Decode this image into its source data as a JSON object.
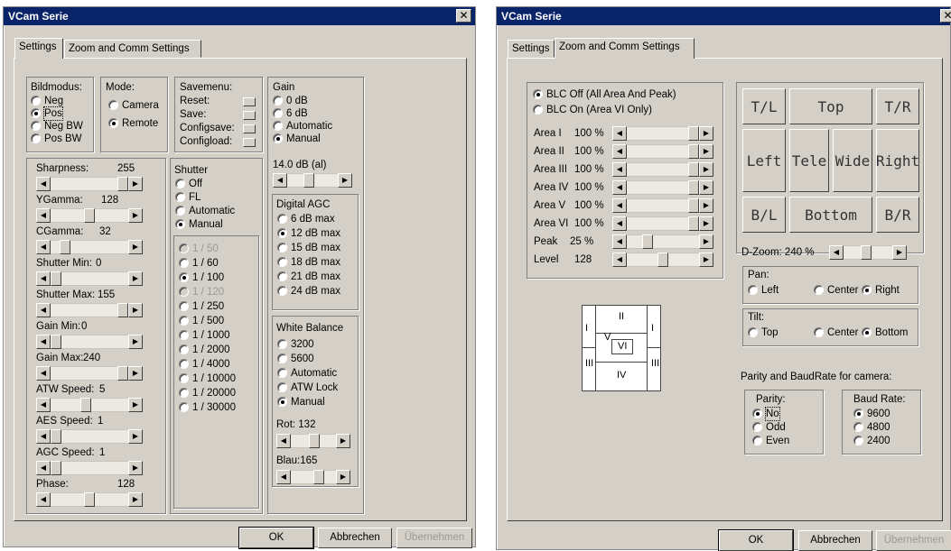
{
  "left": {
    "title": "VCam Serie",
    "close": "✕",
    "tabs": [
      "Settings",
      "Zoom and Comm Settings"
    ],
    "bildmodus": {
      "label": "Bildmodus:",
      "options": [
        "Neg",
        "Pos",
        "Neg BW",
        "Pos BW"
      ],
      "selected": 1
    },
    "mode": {
      "label": "Mode:",
      "options": [
        "Camera",
        "Remote"
      ],
      "selected": 1
    },
    "savemenu": {
      "label": "Savemenu:",
      "items": [
        "Reset:",
        "Save:",
        "Configsave:",
        "Configload:"
      ]
    },
    "gain": {
      "label": "Gain",
      "options": [
        "0 dB",
        "6 dB",
        "Automatic",
        "Manual"
      ],
      "selected": 3,
      "value_text": "14.0  dB  (al)",
      "value_fraction": 0.4
    },
    "dagc": {
      "label": "Digital AGC",
      "options": [
        "6 dB max",
        "12 dB max",
        "15 dB max",
        "18 dB max",
        "21 dB max",
        "24 dB max"
      ],
      "selected": 1
    },
    "wb": {
      "label": "White Balance",
      "options": [
        "3200",
        "5600",
        "Automatic",
        "ATW Lock",
        "Manual"
      ],
      "selected": 4,
      "rot_label": "Rot: 132",
      "rot_fraction": 0.52,
      "blau_label": "Blau:165",
      "blau_fraction": 0.65
    },
    "shutter": {
      "label": "Shutter",
      "modes": [
        "Off",
        "FL",
        "Automatic",
        "Manual"
      ],
      "mode_selected": 3,
      "speeds": [
        "1 / 50",
        "1 / 60",
        "1 / 100",
        "1 / 120",
        "1 / 250",
        "1 / 500",
        "1 / 1000",
        "1 / 2000",
        "1 / 4000",
        "1 / 10000",
        "1 / 20000",
        "1 / 30000"
      ],
      "speed_selected": 2,
      "disabled": [
        0,
        3
      ]
    },
    "sliders": [
      {
        "name": "Sharpness:",
        "value": "255",
        "fraction": 1.0
      },
      {
        "name": "YGamma:",
        "value": "128",
        "fraction": 0.5
      },
      {
        "name": "CGamma:",
        "value": "32",
        "fraction": 0.13
      },
      {
        "name": "Shutter Min:",
        "value": "0",
        "fraction": 0.0
      },
      {
        "name": "Shutter Max:",
        "value": "155",
        "fraction": 1.0
      },
      {
        "name": "Gain Min:",
        "value": "0",
        "fraction": 0.0
      },
      {
        "name": "Gain Max:",
        "value": "240",
        "fraction": 1.0
      },
      {
        "name": "ATW Speed:",
        "value": "5",
        "fraction": 0.45
      },
      {
        "name": "AES Speed:",
        "value": "1",
        "fraction": 0.0
      },
      {
        "name": "AGC Speed:",
        "value": "1",
        "fraction": 0.0
      },
      {
        "name": "Phase:",
        "value": "128",
        "fraction": 0.5
      }
    ],
    "buttons": {
      "ok": "OK",
      "cancel": "Abbrechen",
      "apply": "Übernehmen"
    }
  },
  "right": {
    "title": "VCam Serie",
    "close": "✕",
    "tabs": [
      "Settings",
      "Zoom and Comm Settings"
    ],
    "blc": {
      "options": [
        "BLC Off (All Area And Peak)",
        "BLC On (Area VI Only)"
      ],
      "selected": 0
    },
    "areas": [
      {
        "name": "Area I",
        "value": "100 %",
        "fraction": 1.0
      },
      {
        "name": "Area II",
        "value": "100 %",
        "fraction": 1.0
      },
      {
        "name": "Area III",
        "value": "100 %",
        "fraction": 1.0
      },
      {
        "name": "Area IV",
        "value": "100 %",
        "fraction": 1.0
      },
      {
        "name": "Area V",
        "value": "100 %",
        "fraction": 1.0
      },
      {
        "name": "Area VI",
        "value": "100 %",
        "fraction": 1.0
      },
      {
        "name": "Peak",
        "value": "25 %",
        "fraction": 0.25
      },
      {
        "name": "Level",
        "value": "128",
        "fraction": 0.5
      }
    ],
    "diagram": {
      "labels": [
        "I",
        "II",
        "I",
        "V",
        "VI",
        "III",
        "IV",
        "III"
      ]
    },
    "ptz": {
      "tl": "T/L",
      "top": "Top",
      "tr": "T/R",
      "left": "Left",
      "tele": "Tele",
      "wide": "Wide",
      "right": "Right",
      "bl": "B/L",
      "bottom": "Bottom",
      "br": "B/R"
    },
    "dzoom": {
      "label": "D-Zoom:  240 %",
      "fraction": 0.45
    },
    "pan": {
      "label": "Pan:",
      "options": [
        "Left",
        "Center",
        "Right"
      ],
      "selected": 2
    },
    "tilt": {
      "label": "Tilt:",
      "options": [
        "Top",
        "Center",
        "Bottom"
      ],
      "selected": 2
    },
    "parity_title": "Parity and BaudRate for camera:",
    "parity": {
      "label": "Parity:",
      "options": [
        "No",
        "Odd",
        "Even"
      ],
      "selected": 0
    },
    "baud": {
      "label": "Baud Rate:",
      "options": [
        "9600",
        "4800",
        "2400"
      ],
      "selected": 0
    },
    "buttons": {
      "ok": "OK",
      "cancel": "Abbrechen",
      "apply": "Übernehmen"
    }
  }
}
